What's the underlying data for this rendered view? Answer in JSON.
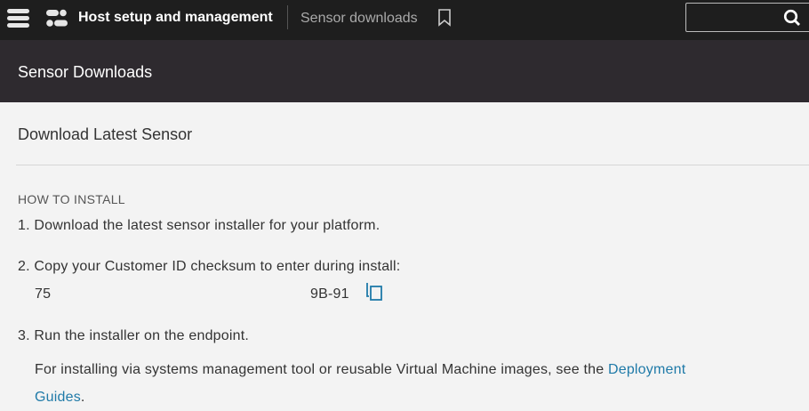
{
  "topbar": {
    "app_title": "Host setup and management",
    "breadcrumb": "Sensor downloads",
    "search_placeholder": ""
  },
  "header": {
    "title": "Sensor Downloads"
  },
  "section": {
    "title": "Download Latest Sensor",
    "how_label": "HOW TO INSTALL",
    "step1": "1. Download the latest sensor installer for your platform.",
    "step2": "2. Copy your Customer ID checksum to enter during install:",
    "cid_start": "75",
    "cid_end": "9B-91",
    "step3": "3. Run the installer on the endpoint.",
    "step3_note": "For installing via systems management tool or reusable Virtual Machine images, see the ",
    "link1": "Deployment",
    "link2": "Guides",
    "period": "."
  }
}
